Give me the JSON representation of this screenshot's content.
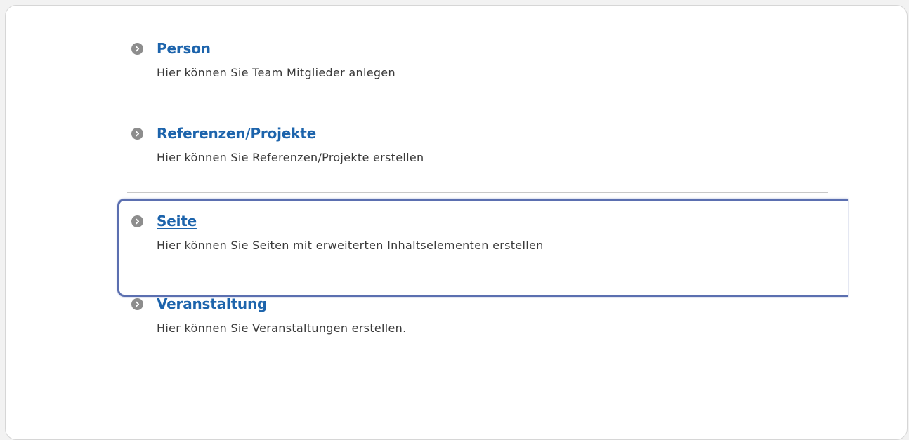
{
  "items": [
    {
      "title": "Person",
      "description": "Hier können Sie Team Mitglieder anlegen"
    },
    {
      "title": "Referenzen/Projekte",
      "description": "Hier können Sie Referenzen/Projekte erstellen"
    },
    {
      "title": "Seite",
      "description": "Hier können Sie Seiten mit erweiterten Inhaltselementen erstellen",
      "highlighted": true
    },
    {
      "title": "Veranstaltung",
      "description": "Hier können Sie Veranstaltungen erstellen."
    }
  ],
  "colors": {
    "link": "#1d64ac",
    "highlight_border": "#5b6fb0",
    "arrow": "#8d8d8d"
  }
}
